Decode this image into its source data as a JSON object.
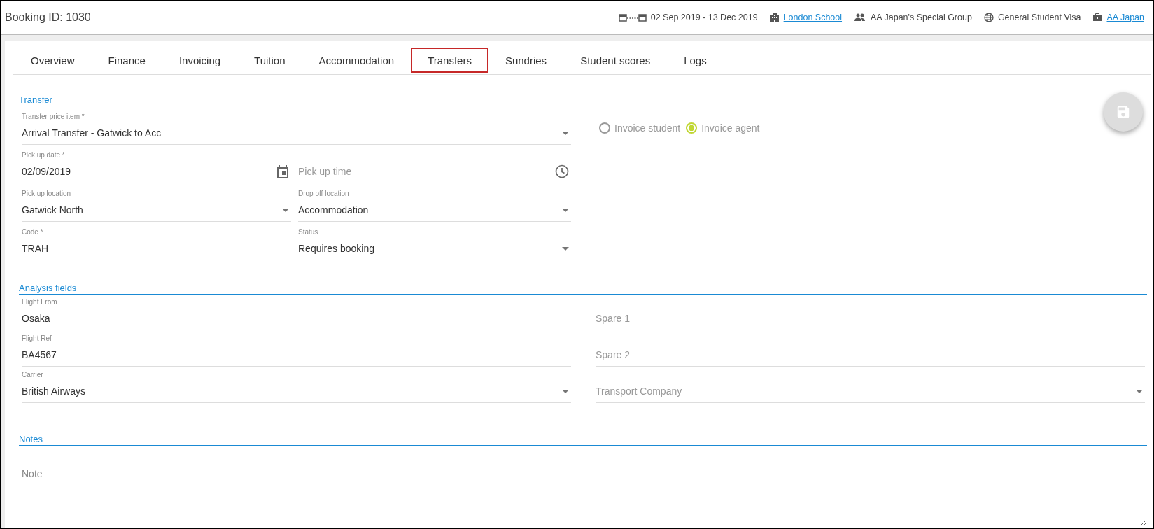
{
  "header": {
    "title": "Booking ID: 1030",
    "items": [
      {
        "kind": "dates",
        "text": "02 Sep 2019 - 13 Dec 2019",
        "link": false
      },
      {
        "kind": "school",
        "text": "London School",
        "link": true
      },
      {
        "kind": "group",
        "text": "AA Japan's Special Group",
        "link": false
      },
      {
        "kind": "visa",
        "text": "General Student Visa",
        "link": false
      },
      {
        "kind": "agent",
        "text": "AA Japan",
        "link": true
      }
    ]
  },
  "tabs": [
    {
      "label": "Overview",
      "selected": false
    },
    {
      "label": "Finance",
      "selected": false
    },
    {
      "label": "Invoicing",
      "selected": false
    },
    {
      "label": "Tuition",
      "selected": false
    },
    {
      "label": "Accommodation",
      "selected": false
    },
    {
      "label": "Transfers",
      "selected": true
    },
    {
      "label": "Sundries",
      "selected": false
    },
    {
      "label": "Student scores",
      "selected": false
    },
    {
      "label": "Logs",
      "selected": false
    }
  ],
  "transfer": {
    "title": "Transfer",
    "fields": [
      {
        "kind": "select",
        "label": "Transfer price item *",
        "value": "Arrival Transfer - Gatwick to Acc",
        "wide": true
      },
      {
        "kind": "date",
        "label": "Pick up date *",
        "value": "02/09/2019",
        "wide": false
      },
      {
        "kind": "time",
        "placeholder": "Pick up time",
        "wide": false
      },
      {
        "kind": "select",
        "label": "Pick up location",
        "value": "Gatwick North",
        "wide": false
      },
      {
        "kind": "select",
        "label": "Drop off location",
        "value": "Accommodation",
        "wide": false
      },
      {
        "kind": "text",
        "label": "Code *",
        "value": "TRAH",
        "wide": false
      },
      {
        "kind": "select",
        "label": "Status",
        "value": "Requires booking",
        "wide": false
      }
    ],
    "invoice_options": [
      {
        "label": "Invoice student",
        "selected": false
      },
      {
        "label": "Invoice agent",
        "selected": true
      }
    ]
  },
  "analysis": {
    "title": "Analysis fields",
    "fields": [
      {
        "kind": "text",
        "label": "Flight From",
        "value": "Osaka"
      },
      {
        "kind": "text",
        "placeholder": "Spare 1"
      },
      {
        "kind": "text",
        "label": "Flight Ref",
        "value": "BA4567"
      },
      {
        "kind": "text",
        "placeholder": "Spare 2"
      },
      {
        "kind": "select",
        "label": "Carrier",
        "value": "British Airways"
      },
      {
        "kind": "select",
        "placeholder": "Transport Company"
      }
    ]
  },
  "notes": {
    "title": "Notes",
    "placeholder": "Note"
  }
}
